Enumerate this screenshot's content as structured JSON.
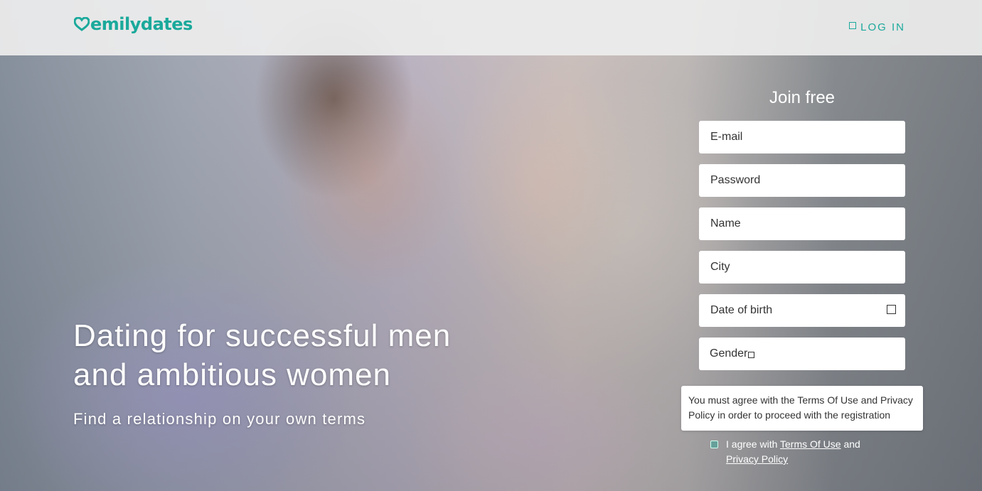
{
  "header": {
    "logo_text": "emilydates",
    "login_label": "LOG IN"
  },
  "hero": {
    "title": "Dating for successful men and ambitious women",
    "subtitle": "Find a relationship on your own terms"
  },
  "form": {
    "title": "Join free",
    "email_placeholder": "E-mail",
    "password_placeholder": "Password",
    "name_placeholder": "Name",
    "city_placeholder": "City",
    "dob_placeholder": "Date of birth",
    "gender_label": "Gender",
    "tooltip": "You must agree with the Terms Of Use and Privacy Policy in order to proceed with the registration",
    "agree_prefix": "I agree with ",
    "terms_link": "Terms Of Use",
    "agree_mid": " and ",
    "privacy_link": "Privacy Policy"
  },
  "colors": {
    "brand": "#1aa99b",
    "header_bg": "#eeeeee"
  },
  "icons": [
    "heart-logo-icon",
    "login-icon",
    "calendar-icon",
    "gender-dropdown-icon",
    "checkbox-icon"
  ]
}
